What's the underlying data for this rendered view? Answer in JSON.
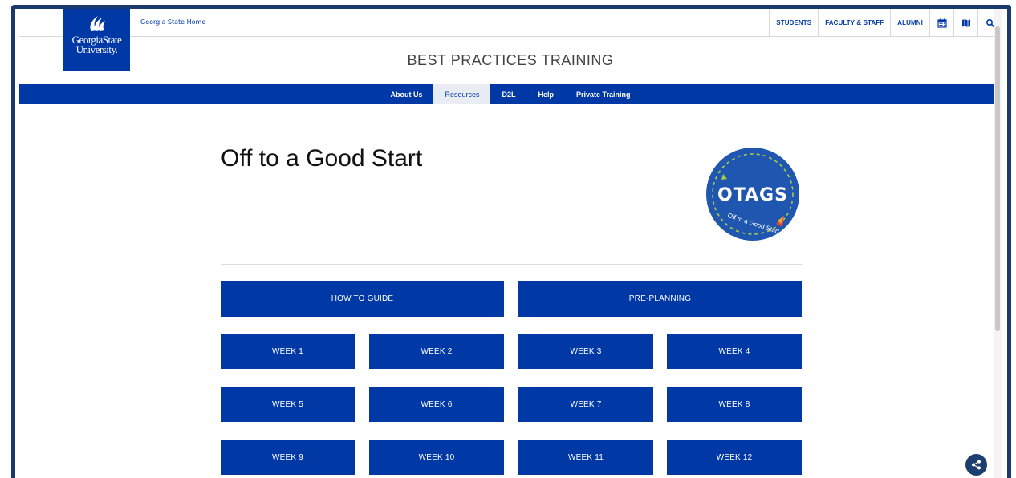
{
  "utility": {
    "home_link": "Georgia State Home",
    "links": [
      "STUDENTS",
      "FACULTY & STAFF",
      "ALUMNI"
    ]
  },
  "logo": {
    "line1": "GeorgiaState",
    "line2": "University."
  },
  "site_title": "BEST PRACTICES TRAINING",
  "nav": {
    "items": [
      "About Us",
      "Resources",
      "D2L",
      "Help",
      "Private Training"
    ],
    "active": "Resources"
  },
  "main": {
    "title": "Off to a Good Start",
    "badge": {
      "acronym": "OTAGS",
      "tagline": "Off to a Good Start"
    }
  },
  "tiles": {
    "guide": "HOW TO GUIDE",
    "preplanning": "PRE-PLANNING",
    "weeks": [
      "WEEK 1",
      "WEEK 2",
      "WEEK 3",
      "WEEK 4",
      "WEEK 5",
      "WEEK 6",
      "WEEK 7",
      "WEEK 8",
      "WEEK 9",
      "WEEK 10",
      "WEEK 11",
      "WEEK 12"
    ]
  },
  "icons": [
    "calendar-icon",
    "map-icon",
    "search-icon",
    "share-icon"
  ],
  "colors": {
    "brand_blue": "#0039a6",
    "frame": "#1a3a6b",
    "badge_bg": "#1f56b0",
    "badge_dash": "#a9c94b",
    "share": "#1d3f70"
  }
}
